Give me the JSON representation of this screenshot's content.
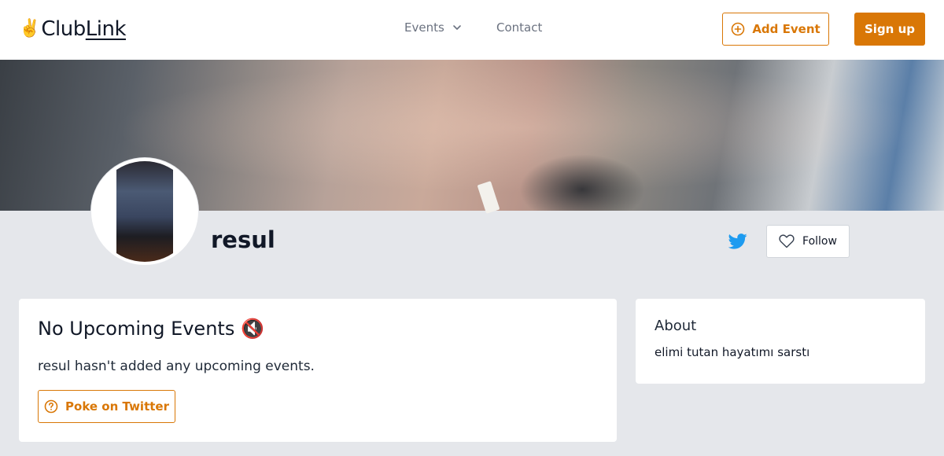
{
  "header": {
    "logo_emoji": "✌️",
    "logo_text_primary": "Club",
    "logo_text_secondary": "Link",
    "nav": {
      "events_label": "Events",
      "contact_label": "Contact"
    },
    "add_event_label": "Add Event",
    "signup_label": "Sign up"
  },
  "profile": {
    "name": "resul",
    "follow_label": "Follow"
  },
  "events_card": {
    "title": "No Upcoming Events",
    "title_emoji": "🔇",
    "description": "resul hasn't added any upcoming events.",
    "poke_label": "Poke on Twitter"
  },
  "about_card": {
    "title": "About",
    "text": "elimi tutan hayatımı sarstı"
  },
  "colors": {
    "accent": "#d97706",
    "page_background": "#e5e7eb",
    "twitter": "#1d9bf0"
  },
  "icons": {
    "add_event": "plus-circle-icon",
    "events_dropdown": "chevron-down-icon",
    "twitter": "twitter-icon",
    "follow": "heart-icon",
    "poke": "question-circle-icon"
  }
}
